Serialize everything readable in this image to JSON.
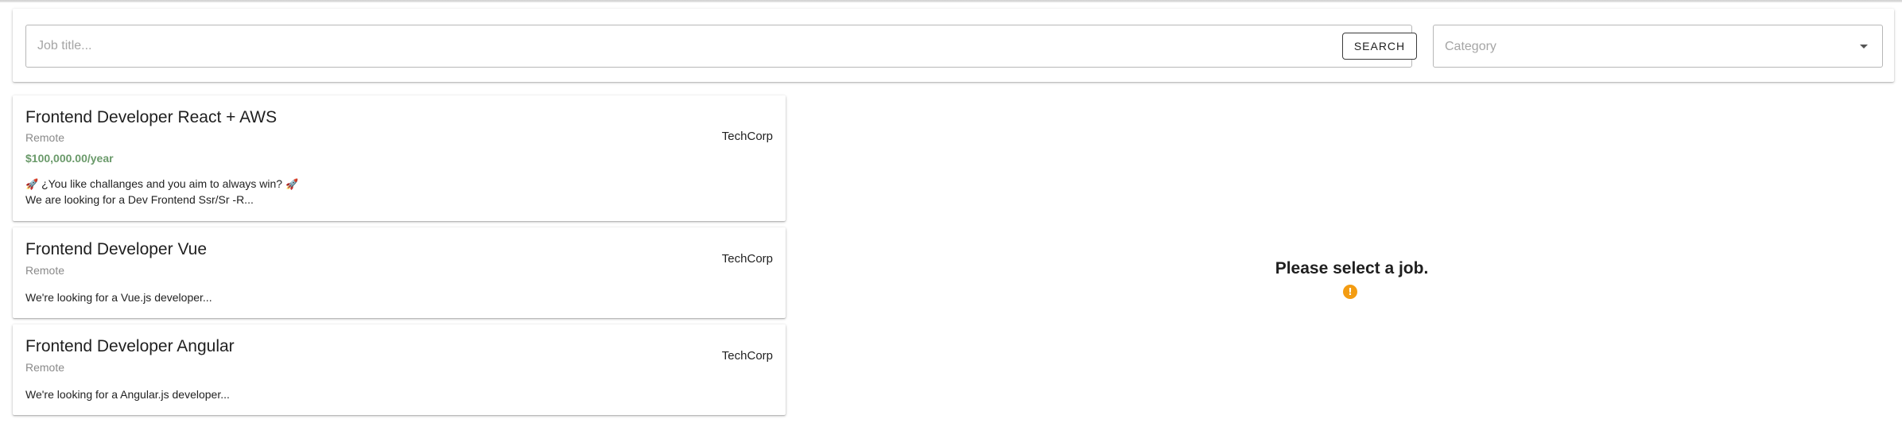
{
  "search": {
    "job_placeholder": "Job title...",
    "job_value": "",
    "button_label": "SEARCH",
    "category_placeholder": "Category",
    "category_icon": "chevron-down-icon"
  },
  "jobs": [
    {
      "title": "Frontend Developer React + AWS",
      "location": "Remote",
      "salary": "$100,000.00/year",
      "company": "TechCorp",
      "description_line1": "¿You like challanges and you aim to always win?",
      "description_line2": "We are looking for a Dev Frontend Ssr/Sr -R..."
    },
    {
      "title": "Frontend Developer Vue",
      "location": "Remote",
      "company": "TechCorp",
      "description_line1": "We're looking for a Vue.js developer..."
    },
    {
      "title": "Frontend Developer Angular",
      "location": "Remote",
      "company": "TechCorp",
      "description_line1": "We're looking for a Angular.js developer..."
    }
  ],
  "detail": {
    "empty_message": "Please select a job.",
    "icon": "warning-icon",
    "icon_color": "#f39c12"
  },
  "colors": {
    "salary": "#6a9a6a",
    "accent_warning": "#f39c12"
  }
}
